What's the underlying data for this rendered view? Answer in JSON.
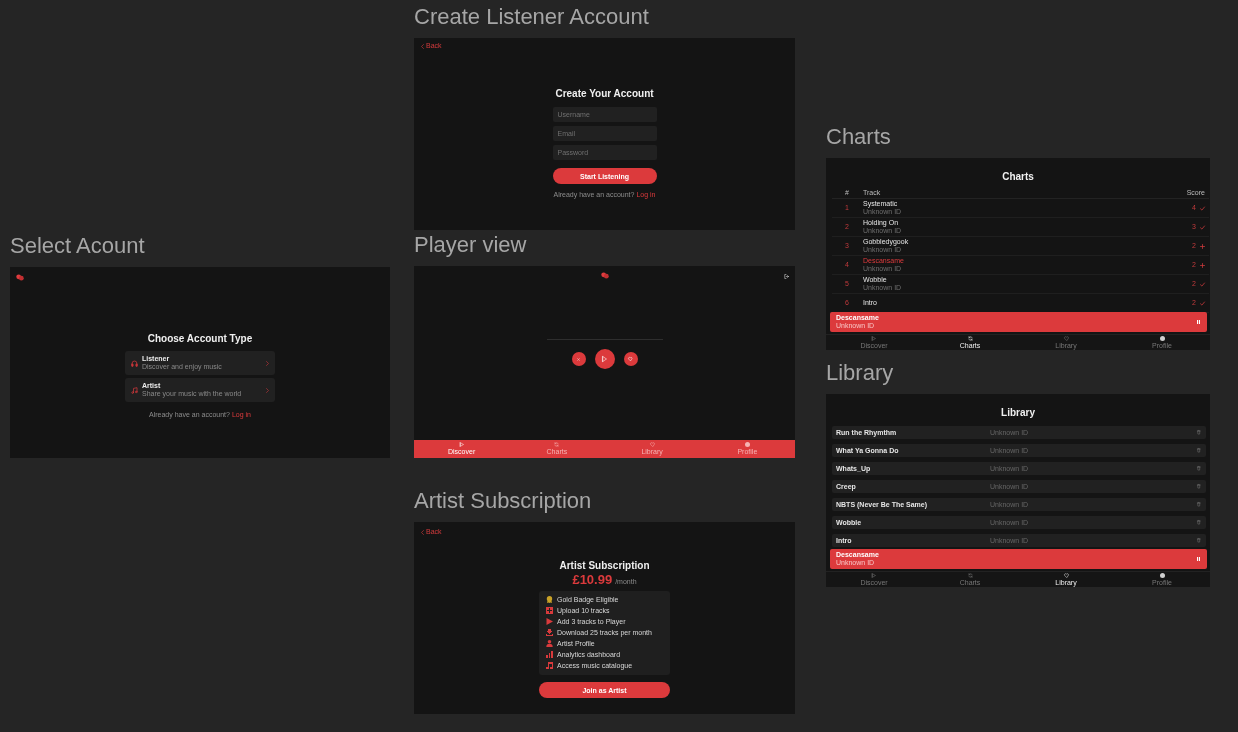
{
  "select_account": {
    "frame_label": "Select Acount",
    "heading": "Choose Account Type",
    "options": [
      {
        "kind": "listener",
        "title": "Listener",
        "description": "Discover and enjoy music"
      },
      {
        "kind": "artist",
        "title": "Artist",
        "description": "Share your music with the world"
      }
    ],
    "login_prompt": {
      "text": "Already have an account?",
      "link": "Log in"
    }
  },
  "create_listener_account": {
    "frame_label": "Create Listener Account",
    "back_link": "Back",
    "heading": "Create Your Account",
    "fields": [
      {
        "placeholder": "Username"
      },
      {
        "placeholder": "Email"
      },
      {
        "placeholder": "Password"
      }
    ],
    "submit_button": "Start Listening",
    "login_prompt": {
      "text": "Already have an account?",
      "link": "Log in"
    }
  },
  "player_view": {
    "frame_label": "Player view",
    "nav": [
      {
        "kind": "discover",
        "label": "Discover",
        "selected": true
      },
      {
        "kind": "charts",
        "label": "Charts",
        "selected": false
      },
      {
        "kind": "library",
        "label": "Library",
        "selected": false
      },
      {
        "kind": "profile",
        "label": "Profile",
        "selected": false
      }
    ]
  },
  "artist_subscription": {
    "frame_label": "Artist Subscription",
    "back_link": "Back",
    "heading": "Artist Subscription",
    "price": "£10.99",
    "period": "/month",
    "features": [
      {
        "kind": "badge",
        "text": "Gold Badge Eligible",
        "color": "#c9a227"
      },
      {
        "kind": "upload",
        "text": "Upload 10 tracks",
        "color": "#d93a3c"
      },
      {
        "kind": "play",
        "text": "Add 3 tracks to Player",
        "color": "#d93a3c"
      },
      {
        "kind": "download",
        "text": "Download 25 tracks per month",
        "color": "#d93a3c"
      },
      {
        "kind": "profile",
        "text": "Artist Profile",
        "color": "#d93a3c"
      },
      {
        "kind": "analytics",
        "text": "Analytics dashboard",
        "color": "#d93a3c"
      },
      {
        "kind": "music",
        "text": "Access music catalogue",
        "color": "#d93a3c"
      }
    ],
    "join_button": "Join as Artist"
  },
  "charts": {
    "frame_label": "Charts",
    "heading": "Charts",
    "columns": [
      "#",
      "Track",
      "Score"
    ],
    "rows": [
      {
        "rank": "1",
        "title": "Systematic",
        "artist": "Unknown ID",
        "score": "4",
        "in_library": true,
        "playing": false
      },
      {
        "rank": "2",
        "title": "Holding On",
        "artist": "Unknown ID",
        "score": "3",
        "in_library": true,
        "playing": false
      },
      {
        "rank": "3",
        "title": "Gobbledygook",
        "artist": "Unknown ID",
        "score": "2",
        "in_library": false,
        "playing": false
      },
      {
        "rank": "4",
        "title": "Descansame",
        "artist": "Unknown ID",
        "score": "2",
        "in_library": false,
        "playing": true
      },
      {
        "rank": "5",
        "title": "Wobble",
        "artist": "Unknown ID",
        "score": "2",
        "in_library": true,
        "playing": false
      },
      {
        "rank": "6",
        "title": "Intro",
        "score": "2",
        "in_library": true,
        "playing": false
      }
    ],
    "now_playing": {
      "title": "Descansame",
      "artist": "Unknown ID"
    },
    "nav": [
      {
        "kind": "discover",
        "label": "Discover",
        "selected": false
      },
      {
        "kind": "charts",
        "label": "Charts",
        "selected": true
      },
      {
        "kind": "library",
        "label": "Library",
        "selected": false
      },
      {
        "kind": "profile",
        "label": "Profile",
        "selected": false
      }
    ]
  },
  "library": {
    "frame_label": "Library",
    "heading": "Library",
    "rows": [
      {
        "title": "Run the Rhymthm",
        "artist": "Unknown ID"
      },
      {
        "title": "What Ya Gonna Do",
        "artist": "Unknown ID"
      },
      {
        "title": "Whats_Up",
        "artist": "Unknown ID"
      },
      {
        "title": "Creep",
        "artist": "Unknown ID"
      },
      {
        "title": "NBTS (Never Be The Same)",
        "artist": "Unknown ID"
      },
      {
        "title": "Wobble",
        "artist": "Unknown ID"
      },
      {
        "title": "Intro",
        "artist": "Unknown ID"
      }
    ],
    "now_playing": {
      "title": "Descansame",
      "artist": "Unknown ID"
    },
    "nav": [
      {
        "kind": "discover",
        "label": "Discover",
        "selected": false
      },
      {
        "kind": "charts",
        "label": "Charts",
        "selected": false
      },
      {
        "kind": "library",
        "label": "Library",
        "selected": true
      },
      {
        "kind": "profile",
        "label": "Profile",
        "selected": false
      }
    ]
  }
}
